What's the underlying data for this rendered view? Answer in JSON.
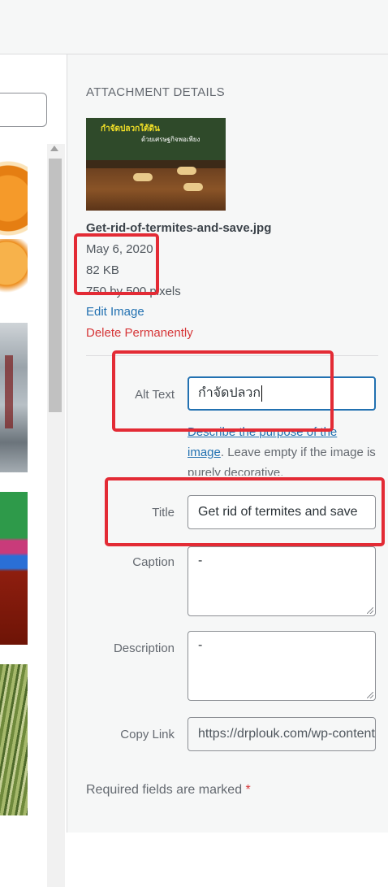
{
  "details": {
    "section_title": "ATTACHMENT DETAILS",
    "preview": {
      "headline": "กำจัดปลวกใต้ดิน",
      "subline": "ด้วยเศรษฐกิจพอเพียง"
    },
    "filename": "Get-rid-of-termites-and-save.jpg",
    "date": "May 6, 2020",
    "filesize": "82 KB",
    "dimensions": "750 by 500 pixels",
    "edit_label": "Edit Image",
    "delete_label": "Delete Permanently"
  },
  "fields": {
    "alt_text": {
      "label": "Alt Text",
      "value": "กำจัดปลวก",
      "help_link": "Describe the purpose of the image",
      "help_rest": ". Leave empty if the image is purely decorative."
    },
    "title": {
      "label": "Title",
      "value": "Get rid of termites and save"
    },
    "caption": {
      "label": "Caption",
      "value": "-"
    },
    "description": {
      "label": "Description",
      "value": "-"
    },
    "copy_link": {
      "label": "Copy Link",
      "value": "https://drplouk.com/wp-content/uploads/Get-rid-of-termites-and-save.jpg"
    }
  },
  "footer": {
    "required_text": "Required fields are marked",
    "required_star": "*"
  },
  "colors": {
    "annotation": "#e32b35",
    "link": "#2271b1",
    "danger": "#d63638"
  },
  "icons": [
    "scroll-up-arrow-icon"
  ]
}
